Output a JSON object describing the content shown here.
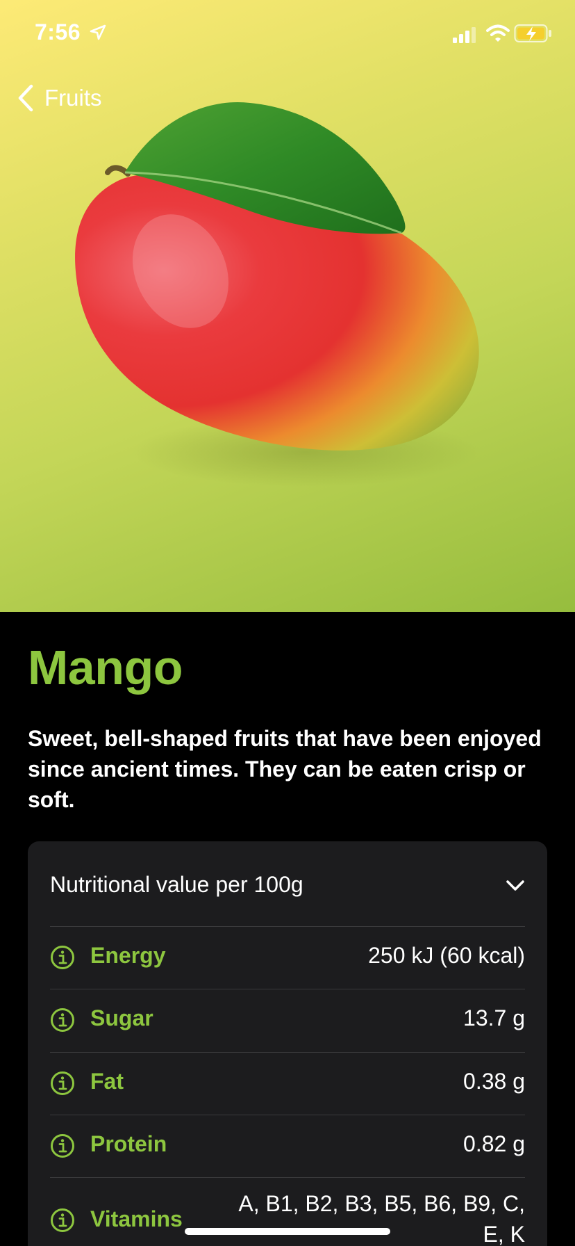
{
  "status_bar": {
    "time": "7:56",
    "location_icon": "location-arrow-icon",
    "signal_icon": "cellular-signal-icon",
    "wifi_icon": "wifi-icon",
    "battery_icon": "battery-charging-icon"
  },
  "navigation": {
    "back_label": "Fruits",
    "back_icon": "chevron-left-icon"
  },
  "hero": {
    "image": "mango-with-leaf",
    "gradient_colors": [
      "#fdea76",
      "#c4d658",
      "#96bd3e"
    ]
  },
  "fruit": {
    "name": "Mango",
    "description": "Sweet, bell-shaped fruits that have been enjoyed since ancient times. They can be eaten crisp or soft."
  },
  "nutrition": {
    "header": "Nutritional value per 100g",
    "expanded": true,
    "rows": [
      {
        "name": "Energy",
        "value": "250 kJ (60 kcal)"
      },
      {
        "name": "Sugar",
        "value": "13.7 g"
      },
      {
        "name": "Fat",
        "value": "0.38 g"
      },
      {
        "name": "Protein",
        "value": "0.82 g"
      },
      {
        "name": "Vitamins",
        "value_line1": "A, B1, B2, B3, B5, B6, B9, C,",
        "value_line2": "E, K"
      }
    ]
  },
  "colors": {
    "accent": "#8dc63f",
    "background": "#000000",
    "card": "#1c1c1e",
    "separator": "#3a3a3c",
    "text": "#ffffff"
  }
}
